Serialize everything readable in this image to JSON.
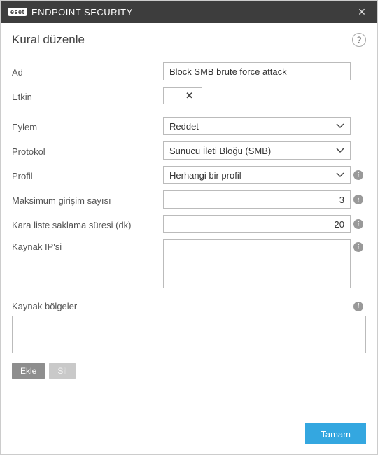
{
  "titlebar": {
    "brand": "eset",
    "product": "ENDPOINT SECURITY"
  },
  "header": {
    "title": "Kural düzenle"
  },
  "labels": {
    "name": "Ad",
    "enabled": "Etkin",
    "action": "Eylem",
    "protocol": "Protokol",
    "profile": "Profil",
    "max_attempts": "Maksimum girişim sayısı",
    "blacklist_retention": "Kara liste saklama süresi (dk)",
    "source_ip": "Kaynak IP'si",
    "source_regions": "Kaynak bölgeler"
  },
  "values": {
    "name": "Block SMB brute force attack",
    "enabled": false,
    "action": "Reddet",
    "protocol": "Sunucu İleti Bloğu (SMB)",
    "profile": "Herhangi bir profil",
    "max_attempts": "3",
    "blacklist_retention": "20",
    "source_ip": "",
    "source_regions": ""
  },
  "buttons": {
    "add": "Ekle",
    "delete": "Sil",
    "ok": "Tamam"
  }
}
